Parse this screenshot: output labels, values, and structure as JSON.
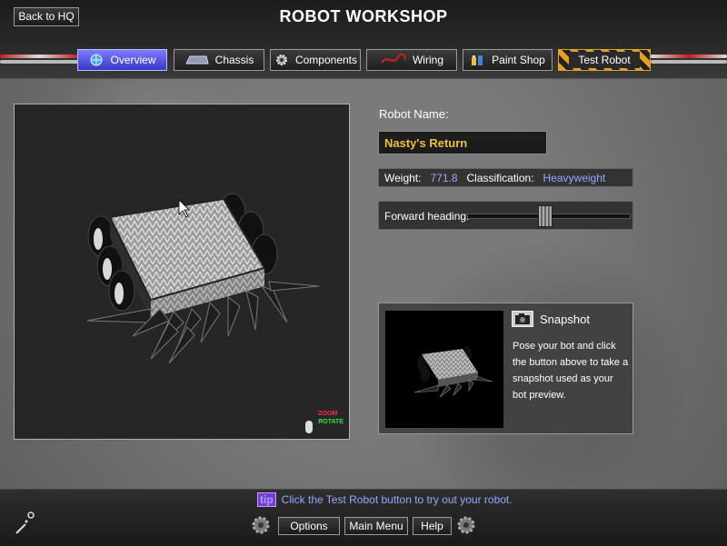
{
  "header": {
    "title": "ROBOT WORKSHOP",
    "back_label": "Back to HQ"
  },
  "tabs": [
    {
      "label": "Overview",
      "icon": "globe-icon",
      "active": true
    },
    {
      "label": "Chassis",
      "icon": "chassis-icon",
      "active": false
    },
    {
      "label": "Components",
      "icon": "gear-icon",
      "active": false
    },
    {
      "label": "Wiring",
      "icon": "wire-icon",
      "active": false
    },
    {
      "label": "Paint Shop",
      "icon": "paint-cans-icon",
      "active": false
    },
    {
      "label": "Test Robot",
      "icon": "",
      "active": false
    }
  ],
  "viewport": {
    "zoom_label": "ZOOM",
    "rotate_label": "ROTATE"
  },
  "robot": {
    "name_label": "Robot Name:",
    "name_value": "Nasty's Return",
    "weight_label": "Weight:",
    "weight_value": "771.8",
    "class_label": "Classification:",
    "class_value": "Heavyweight",
    "heading_label": "Forward heading:",
    "heading_level": 0.48
  },
  "snapshot": {
    "title": "Snapshot",
    "description": "Pose your bot and click the button above to take a snapshot used as your bot preview."
  },
  "footer": {
    "tip_badge": "tip",
    "tip_text": "Click the Test Robot button to try out your robot.",
    "options_label": "Options",
    "main_menu_label": "Main Menu",
    "help_label": "Help"
  },
  "colors": {
    "accent_blue": "#3a36c8",
    "name_gold": "#f0c040",
    "stat_blue": "#9aa6ff",
    "zoom_red": "#ff2a5a",
    "rotate_green": "#30e040"
  }
}
